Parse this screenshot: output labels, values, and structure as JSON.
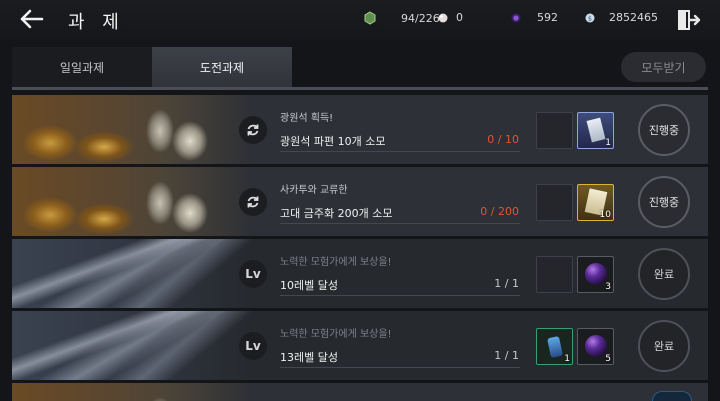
{
  "header": {
    "title": "과 제",
    "currencies": [
      {
        "name": "stamina",
        "value": "94/226",
        "icon": "stamina-icon",
        "color": "#7fb36a"
      },
      {
        "name": "pearl",
        "value": "0",
        "icon": "pearl-icon",
        "color": "#e6dcdc"
      },
      {
        "name": "crystal",
        "value": "592",
        "icon": "purple-crystal-icon",
        "color": "#7a45c8"
      },
      {
        "name": "silver",
        "value": "2852465",
        "icon": "silver-coin-icon",
        "color": "#b8d4ee"
      }
    ]
  },
  "tabs": [
    {
      "label": "일일과제",
      "active": false
    },
    {
      "label": "도전과제",
      "active": true
    }
  ],
  "claim_all_label": "모두받기",
  "missions": [
    {
      "subtitle": "광원석 획득!",
      "title": "광원석 파편 10개 소모",
      "progress": "0 / 10",
      "icon": "refresh-icon",
      "reward_qty": "1",
      "reward_icon": "ore-fragment-icon",
      "status": "진행중"
    },
    {
      "subtitle": "사카투와 교류한",
      "title": "고대 금주화 200개 소모",
      "progress": "0 / 200",
      "icon": "refresh-icon",
      "reward_qty": "10",
      "reward_icon": "scroll-icon",
      "status": "진행중"
    },
    {
      "subtitle": "노력한 모험가에게 보상을!",
      "title": "10레벨 달성",
      "progress": "1 / 1",
      "icon_text": "Lv",
      "reward_qty": "3",
      "reward_icon": "purple-gem-icon",
      "status": "완료"
    },
    {
      "subtitle": "노력한 모험가에게 보상을!",
      "title": "13레벨 달성",
      "progress": "1 / 1",
      "icon_text": "Lv",
      "reward_qty_a": "1",
      "reward_icon_a": "rune-icon",
      "reward_qty": "5",
      "reward_icon": "purple-gem-icon",
      "status": "완료"
    }
  ],
  "colors": {
    "progress_incomplete": "#e2552f",
    "active_tab": "#3d4048",
    "gold_frame": "#e0b22f",
    "blue_frame": "#8ea4e0"
  }
}
